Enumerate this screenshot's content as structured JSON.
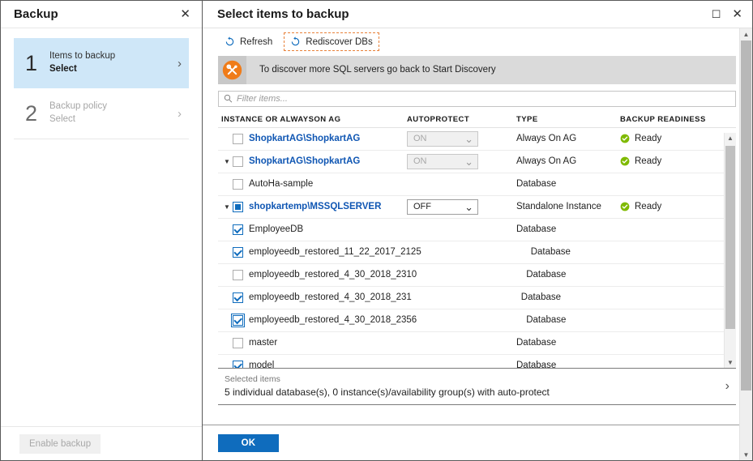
{
  "left_blade": {
    "title": "Backup",
    "close_icon": "close-icon",
    "steps": [
      {
        "num": "1",
        "title": "Items to backup",
        "sub": "Select",
        "chevron": "›",
        "active": true
      },
      {
        "num": "2",
        "title": "Backup policy",
        "sub": "Select",
        "chevron": "›",
        "active": false
      }
    ],
    "footer": {
      "enable_backup_label": "Enable backup"
    }
  },
  "right_blade": {
    "title": "Select items to backup",
    "maximize_icon": "maximize-icon",
    "close_icon": "close-icon",
    "toolbar": {
      "refresh_label": "Refresh",
      "rediscover_label": "Rediscover DBs",
      "highlight_color": "#e8813a"
    },
    "infobar": {
      "icon": "tools-icon",
      "icon_color": "#f07c19",
      "text": "To discover more SQL servers go back to Start Discovery"
    },
    "filter": {
      "placeholder": "Filter items...",
      "value": "",
      "icon": "search-icon"
    },
    "table": {
      "columns": [
        "INSTANCE OR ALWAYSON AG",
        "AUTOPROTECT",
        "TYPE",
        "BACKUP READINESS"
      ],
      "rows": [
        {
          "name": "ShopkartAG\\ShopkartAG",
          "is_link": true,
          "indent": 1,
          "twisty": "",
          "checkbox": "unchecked",
          "autoprotect": "ON",
          "autoprotect_disabled": true,
          "type": "Always On AG",
          "readiness": "Ready"
        },
        {
          "name": "ShopkartAG\\ShopkartAG",
          "is_link": true,
          "indent": 0,
          "twisty": "▼",
          "checkbox": "unchecked",
          "autoprotect": "ON",
          "autoprotect_disabled": true,
          "type": "Always On AG",
          "readiness": "Ready"
        },
        {
          "name": "AutoHa-sample",
          "is_link": false,
          "indent": 2,
          "twisty": "",
          "checkbox": "unchecked",
          "autoprotect": "",
          "autoprotect_disabled": false,
          "type": "Database",
          "readiness": ""
        },
        {
          "name": "shopkartemp\\MSSQLSERVER",
          "is_link": true,
          "indent": 0,
          "twisty": "▼",
          "checkbox": "indeterminate",
          "autoprotect": "OFF",
          "autoprotect_disabled": false,
          "type": "Standalone Instance",
          "readiness": "Ready"
        },
        {
          "name": "EmployeeDB",
          "is_link": false,
          "indent": 2,
          "twisty": "",
          "checkbox": "checked",
          "autoprotect": "",
          "autoprotect_disabled": false,
          "type": "Database",
          "readiness": ""
        },
        {
          "name": "employeedb_restored_11_22_2017_2125",
          "is_link": false,
          "indent": 2,
          "twisty": "",
          "checkbox": "checked",
          "autoprotect": "",
          "autoprotect_disabled": false,
          "type": "Database",
          "readiness": ""
        },
        {
          "name": "employeedb_restored_4_30_2018_2310",
          "is_link": false,
          "indent": 2,
          "twisty": "",
          "checkbox": "unchecked",
          "autoprotect": "",
          "autoprotect_disabled": false,
          "type": "Database",
          "readiness": ""
        },
        {
          "name": "employeedb_restored_4_30_2018_231",
          "is_link": false,
          "indent": 2,
          "twisty": "",
          "checkbox": "checked",
          "autoprotect": "",
          "autoprotect_disabled": false,
          "type": "Database",
          "readiness": ""
        },
        {
          "name": "employeedb_restored_4_30_2018_2356",
          "is_link": false,
          "indent": 2,
          "twisty": "",
          "checkbox": "checked-focused",
          "autoprotect": "",
          "autoprotect_disabled": false,
          "type": "Database",
          "readiness": ""
        },
        {
          "name": "master",
          "is_link": false,
          "indent": 2,
          "twisty": "",
          "checkbox": "unchecked",
          "autoprotect": "",
          "autoprotect_disabled": false,
          "type": "Database",
          "readiness": ""
        },
        {
          "name": "model",
          "is_link": false,
          "indent": 2,
          "twisty": "",
          "checkbox": "checked",
          "autoprotect": "",
          "autoprotect_disabled": false,
          "type": "Database",
          "readiness": ""
        }
      ]
    },
    "selected_bar": {
      "label": "Selected items",
      "value": "5 individual database(s), 0 instance(s)/availability group(s) with auto-protect",
      "chevron": "›"
    },
    "footer": {
      "ok_label": "OK"
    },
    "scrollbars": {
      "up_arrow": "▲",
      "down_arrow": "▼"
    }
  }
}
